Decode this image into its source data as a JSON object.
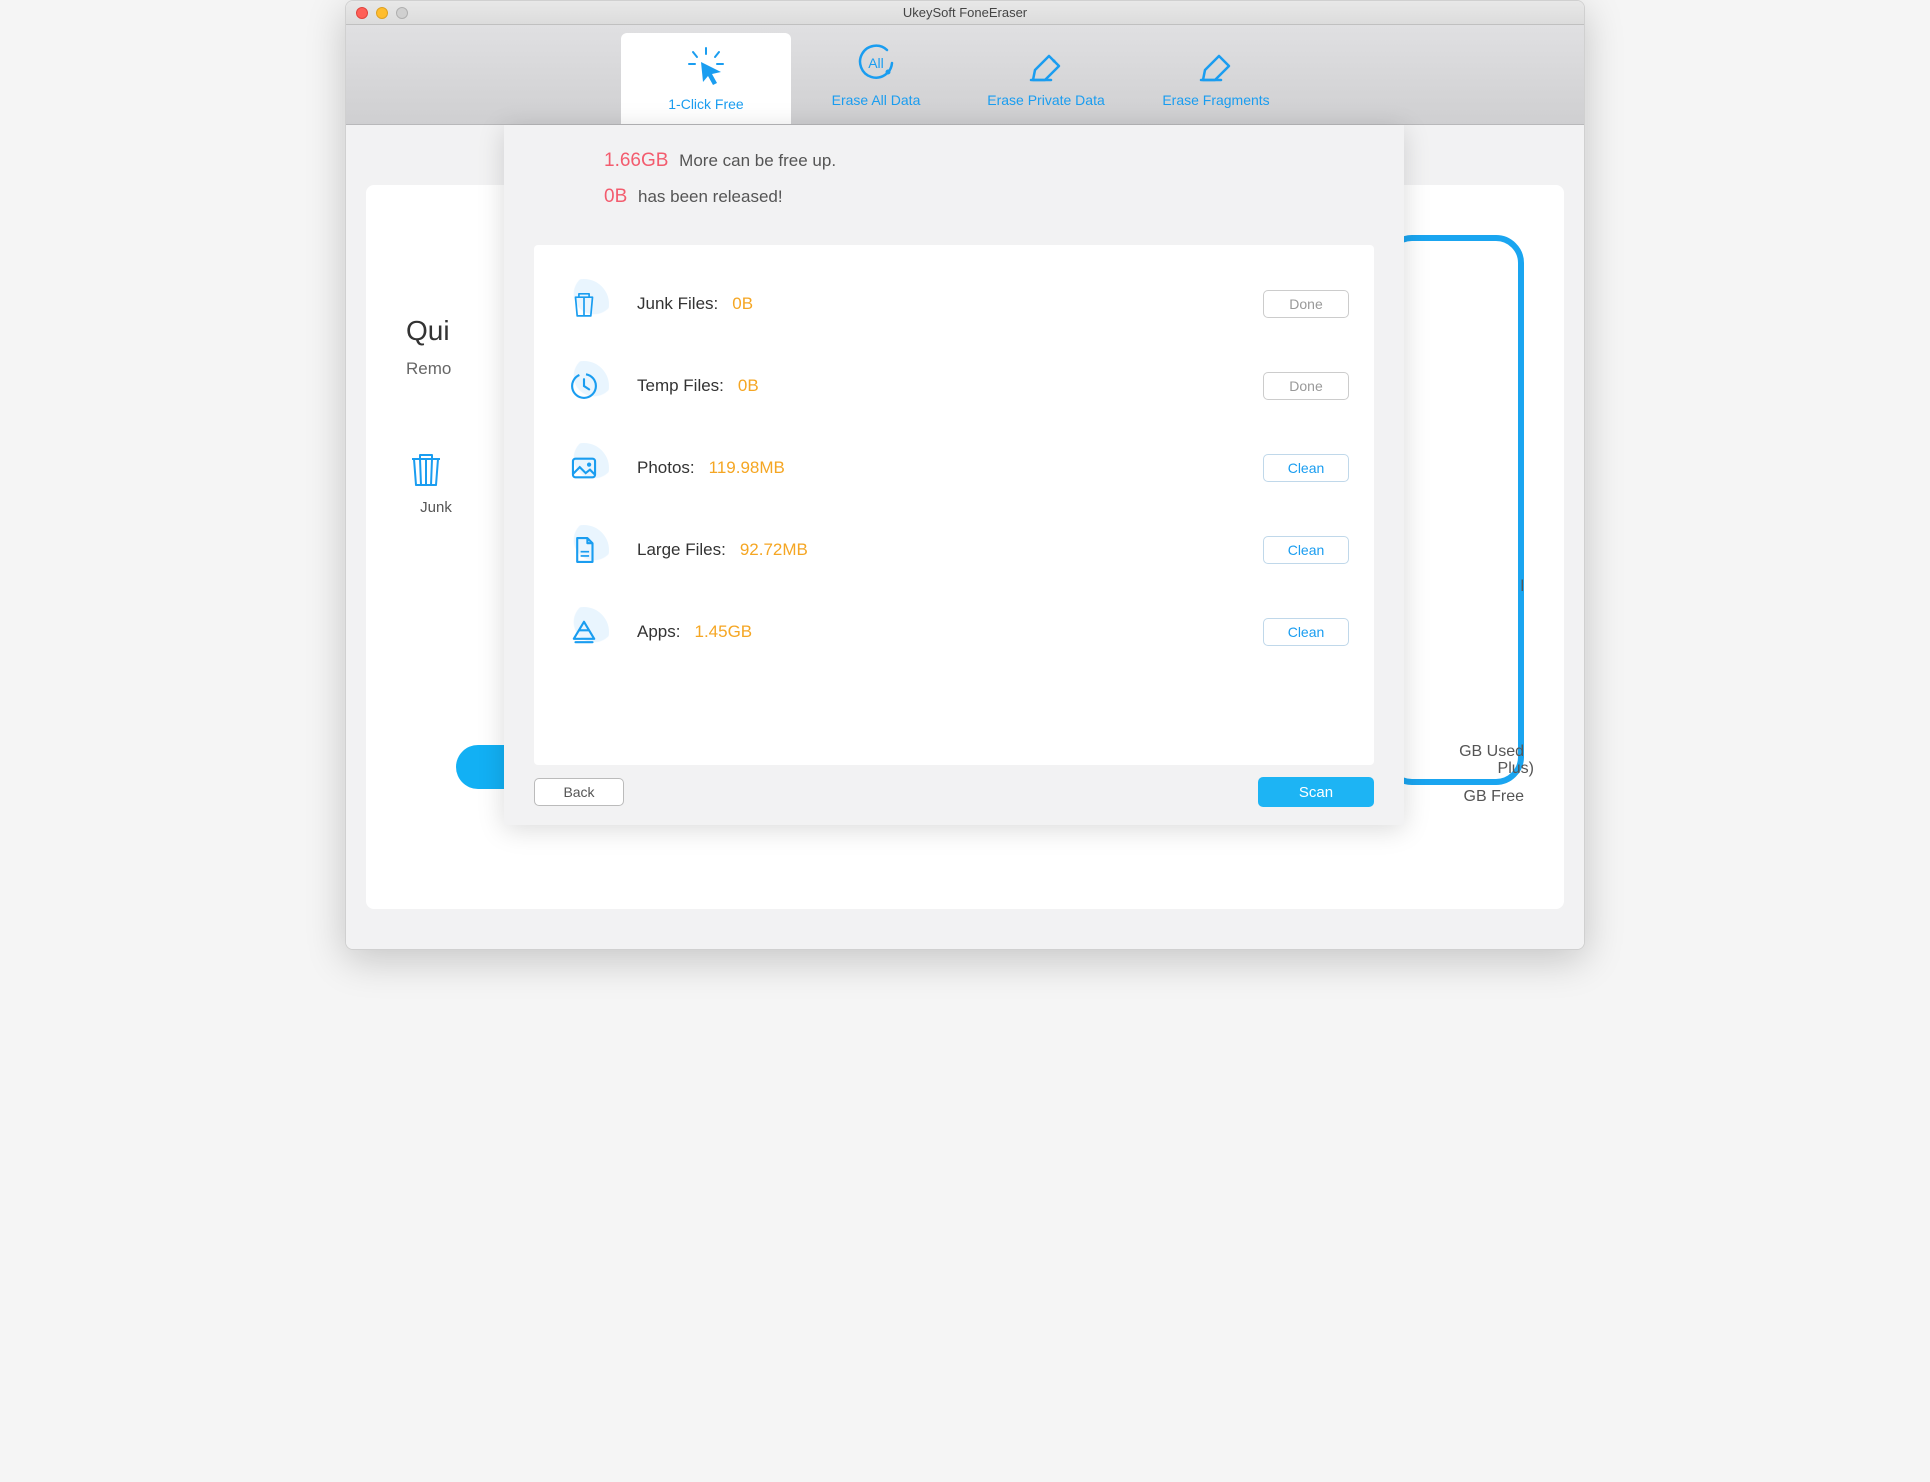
{
  "window": {
    "title": "UkeySoft FoneEraser"
  },
  "tabs": [
    {
      "label": "1-Click Free"
    },
    {
      "label": "Erase All Data"
    },
    {
      "label": "Erase Private Data"
    },
    {
      "label": "Erase Fragments"
    }
  ],
  "summary": {
    "free_amount": "1.66GB",
    "free_text": "More can be free up.",
    "released_amount": "0B",
    "released_text": "has been released!"
  },
  "rows": [
    {
      "label": "Junk Files:",
      "value": "0B",
      "button": "Done",
      "active": false
    },
    {
      "label": "Temp Files:",
      "value": "0B",
      "button": "Done",
      "active": false
    },
    {
      "label": "Photos:",
      "value": "119.98MB",
      "button": "Clean",
      "active": true
    },
    {
      "label": "Large Files:",
      "value": "92.72MB",
      "button": "Clean",
      "active": true
    },
    {
      "label": "Apps:",
      "value": "1.45GB",
      "button": "Clean",
      "active": true
    }
  ],
  "footer": {
    "back": "Back",
    "scan": "Scan"
  },
  "bg": {
    "title": "Qui",
    "sub": "Remo",
    "item_label": "Junk",
    "used": "GB Used",
    "free": "GB Free",
    "model": "Plus)",
    "letter": "l"
  }
}
